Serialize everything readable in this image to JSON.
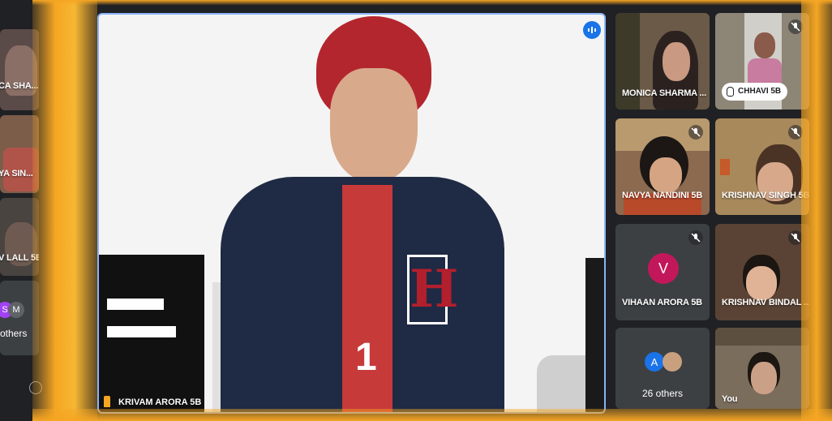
{
  "main_speaker": {
    "name": "KRIVAM ARORA 5B"
  },
  "left_column": {
    "tiles": [
      {
        "name": "CA SHA..."
      },
      {
        "name": "YA SIN..."
      },
      {
        "name": "V LALL 5B"
      }
    ],
    "others": {
      "label": "others",
      "avatars": [
        "S",
        "M"
      ]
    }
  },
  "grid": {
    "monica": {
      "name": "MONICA SHARMA ..."
    },
    "chhavi": {
      "name": "CHHAVI 5B"
    },
    "navya": {
      "name": "NAVYA NANDINI 5B"
    },
    "krishnav_singh": {
      "name": "KRISHNAV SINGH 5B"
    },
    "vihaan": {
      "name": "VIHAAN ARORA 5B",
      "initial": "V"
    },
    "krishnav_bindal": {
      "name": "KRISHNAV BINDAL ..."
    },
    "others": {
      "label": "26 others",
      "initial": "A"
    },
    "you": {
      "name": "You"
    }
  },
  "colors": {
    "accent": "#8ab4f8",
    "avatar_pink": "#c2185b",
    "avatar_blue": "#1a73e8",
    "frame_orange": "#f5a623"
  }
}
